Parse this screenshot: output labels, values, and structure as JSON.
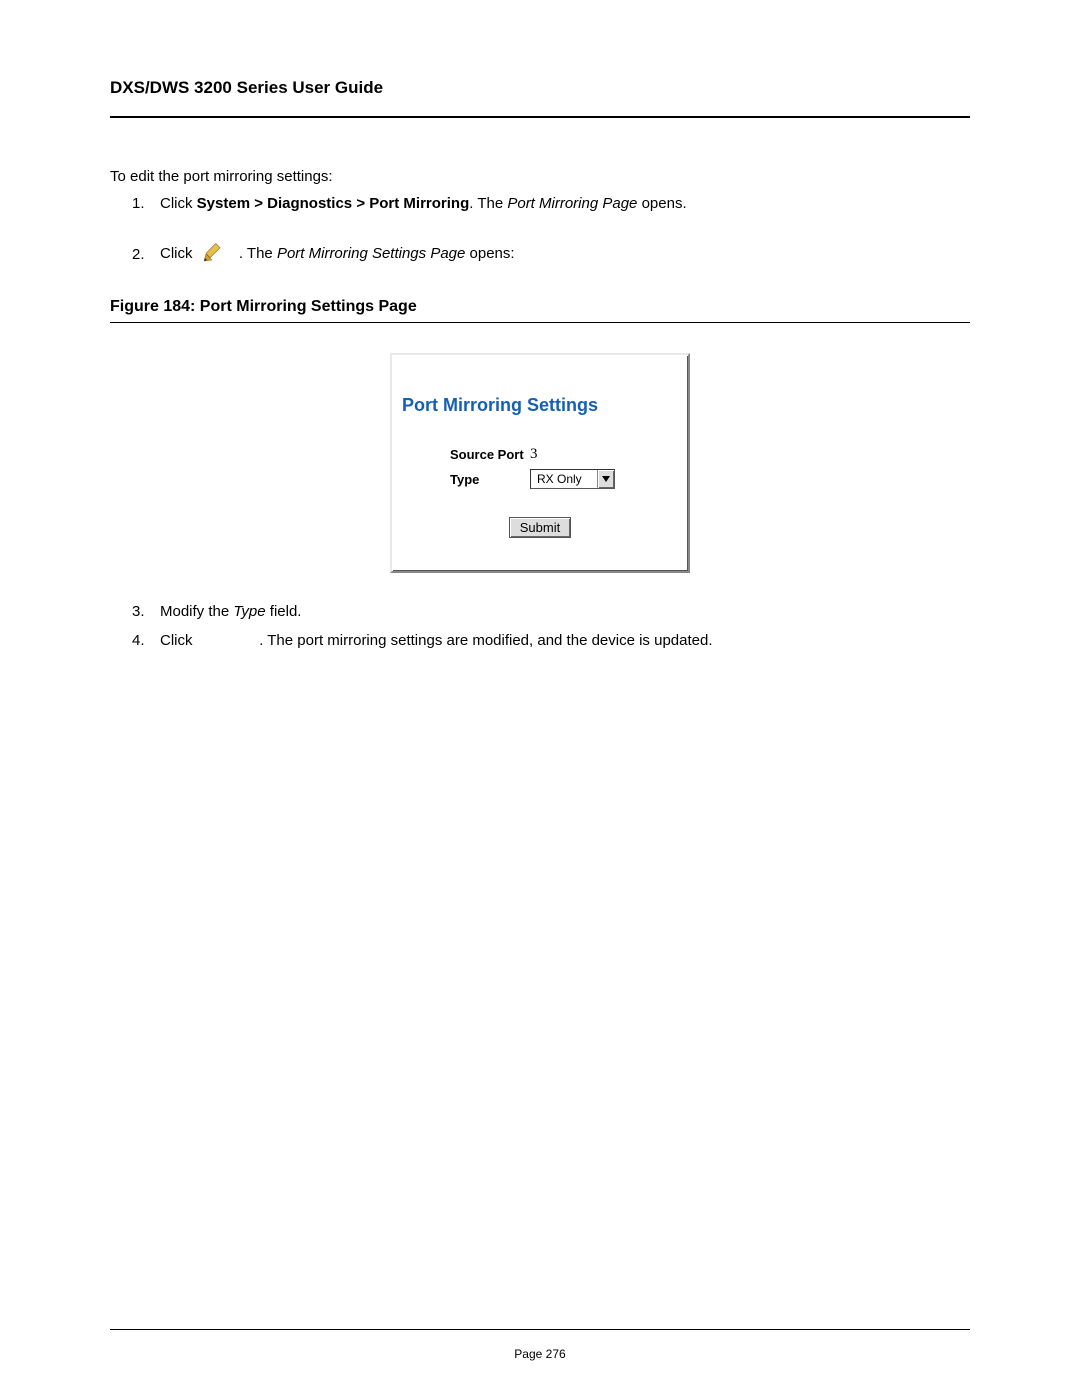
{
  "header": {
    "title": "DXS/DWS 3200 Series User Guide"
  },
  "intro": "To edit the port mirroring settings:",
  "steps": {
    "s1": {
      "num": "1.",
      "pre": "Click ",
      "bold": "System > Diagnostics > Port Mirroring",
      "mid": ". The ",
      "ital": "Port Mirroring Page",
      "post": " opens."
    },
    "s2": {
      "num": "2.",
      "pre": "Click ",
      "mid": ". The ",
      "ital": "Port Mirroring Settings Page",
      "post": " opens:"
    },
    "s3": {
      "num": "3.",
      "pre": "Modify the ",
      "ital": "Type",
      "post": " field."
    },
    "s4": {
      "num": "4.",
      "pre": "Click ",
      "gap": "               ",
      "post": ". The port mirroring settings are modified, and the device is updated."
    }
  },
  "figure": {
    "caption": "Figure 184: Port Mirroring Settings Page"
  },
  "dialog": {
    "title": "Port Mirroring Settings",
    "source_port_label": "Source Port",
    "source_port_value": "3",
    "type_label": "Type",
    "type_value": "RX Only",
    "submit": "Submit"
  },
  "footer": {
    "page": "Page 276"
  }
}
